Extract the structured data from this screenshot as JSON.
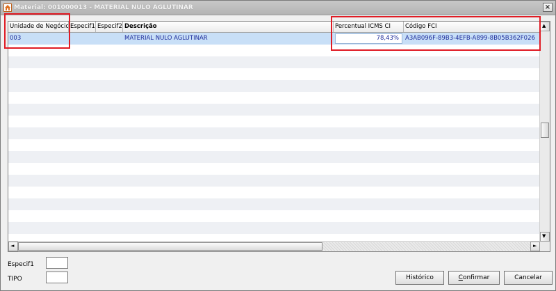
{
  "window": {
    "title": "Material: 001000013 - MATERIAL NULO AGLUTINAR",
    "close_glyph": "×"
  },
  "grid": {
    "columns": [
      {
        "label": "Unidade de Negócio"
      },
      {
        "label": "Especif1"
      },
      {
        "label": "Especif2"
      },
      {
        "label": "Descrição"
      },
      {
        "label": "Percentual ICMS CI"
      },
      {
        "label": "Código FCI"
      }
    ],
    "rows": [
      {
        "unidade": "003",
        "especif1": "",
        "especif2": "",
        "descricao": "MATERIAL NULO AGLUTINAR",
        "percentual": "78,43%",
        "codigo_fci": "A3AB096F-89B3-4EFB-A899-8B05B362F026"
      }
    ],
    "scroll_up_glyph": "▲",
    "scroll_down_glyph": "▼",
    "scroll_left_glyph": "◄",
    "scroll_right_glyph": "►"
  },
  "filters": {
    "especif1_label": "Especif1",
    "tipo_label": "TIPO"
  },
  "buttons": {
    "historico": "Histórico",
    "confirmar_u": "C",
    "confirmar_rest": "onfirmar",
    "cancelar_u": "C",
    "cancelar_rest": "ancelar"
  },
  "colors": {
    "highlight": "#e01b24",
    "selected_row": "#c8dff7",
    "text_blue": "#1b2a9a"
  }
}
